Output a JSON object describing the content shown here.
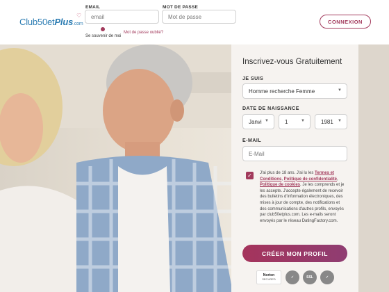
{
  "brand": {
    "logo_main": "Club50et",
    "logo_plus": "Plus",
    "logo_com": ".com"
  },
  "login": {
    "email_label": "EMAIL",
    "email_placeholder": "email",
    "password_label": "MOT DE PASSE",
    "password_placeholder": "Mot de passe",
    "remember_label": "Se souvenir de moi",
    "forgot_label": "Mot de passe oublié?",
    "connect_button": "CONNEXION"
  },
  "signup": {
    "title": "Inscrivez-vous Gratuitement",
    "je_suis_label": "JE SUIS",
    "je_suis_value": "Homme recherche Femme",
    "birth_label": "DATE DE NAISSANCE",
    "birth_month": "Janvi",
    "birth_day": "1",
    "birth_year": "1981",
    "email_label": "E-MAIL",
    "email_placeholder": "E-Mail",
    "consent_pre": "J'ai plus de 18 ans. J'ai lu les ",
    "consent_terms": "Termes et Conditions",
    "consent_sep1": ", ",
    "consent_privacy": "Politique de confidentialité",
    "consent_sep2": ", ",
    "consent_cookies": "Politique de cookies",
    "consent_post": ". Je les comprends et je les accepte. J'accepte également de recevoir des bulletins d'information électroniques, des mises à jour de compte, des notifications et des communications d'autres profils, envoyés par club50etplus.com. Les e-mails seront envoyés par le réseau DatingFactory.com.",
    "submit_button": "CRÉER MON PROFIL"
  },
  "badges": {
    "norton_line1": "Norton",
    "norton_line2": "SECURED",
    "norton_line3": "powered by VeriSign",
    "seal2": "✓",
    "seal3": "SSL",
    "seal4": "✓"
  },
  "colors": {
    "accent": "#a23a5c",
    "logo_blue": "#2d7db3",
    "card_bg": "#f6f3f0"
  },
  "icons": {
    "chevron": "chevron-down-icon",
    "check": "check-icon",
    "heart": "heart-icon"
  }
}
